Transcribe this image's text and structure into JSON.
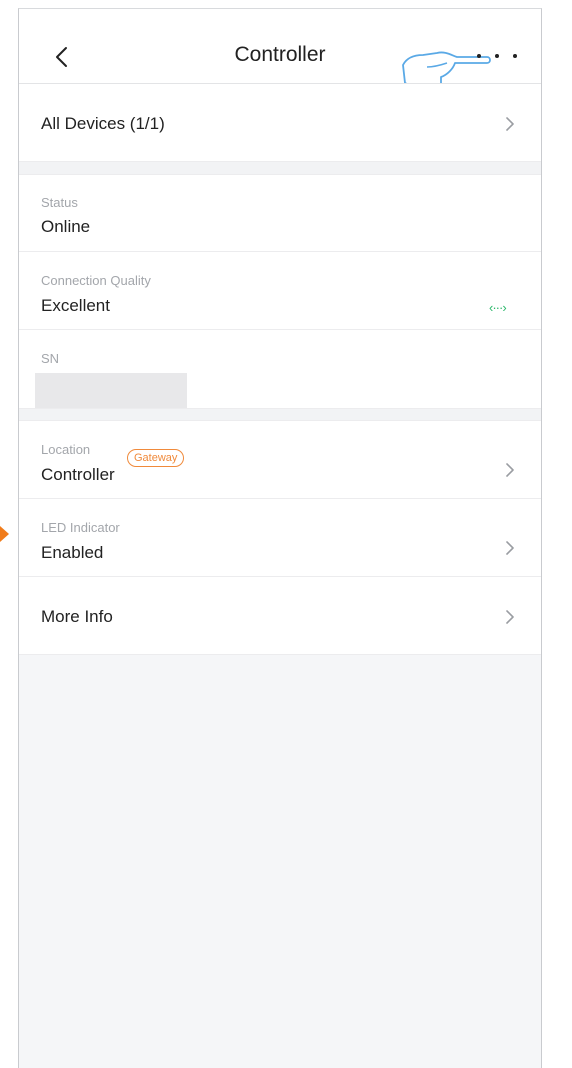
{
  "header": {
    "title": "Controller"
  },
  "all_devices": {
    "label": "All Devices (1/1)"
  },
  "status": {
    "caption": "Status",
    "value": "Online"
  },
  "connection_quality": {
    "caption": "Connection Quality",
    "value": "Excellent",
    "icon": "connection-icon",
    "icon_glyph": "‹···›",
    "icon_color": "#2db86b"
  },
  "sn": {
    "caption": "SN",
    "value_redacted": true
  },
  "location": {
    "caption": "Location",
    "badge": "Gateway",
    "value": "Controller"
  },
  "led_indicator": {
    "caption": "LED Indicator",
    "value": "Enabled"
  },
  "more_info": {
    "label": "More Info"
  },
  "colors": {
    "accent_orange": "#f08a3b",
    "connection_green": "#2db86b",
    "page_bg": "#f5f6f8"
  }
}
